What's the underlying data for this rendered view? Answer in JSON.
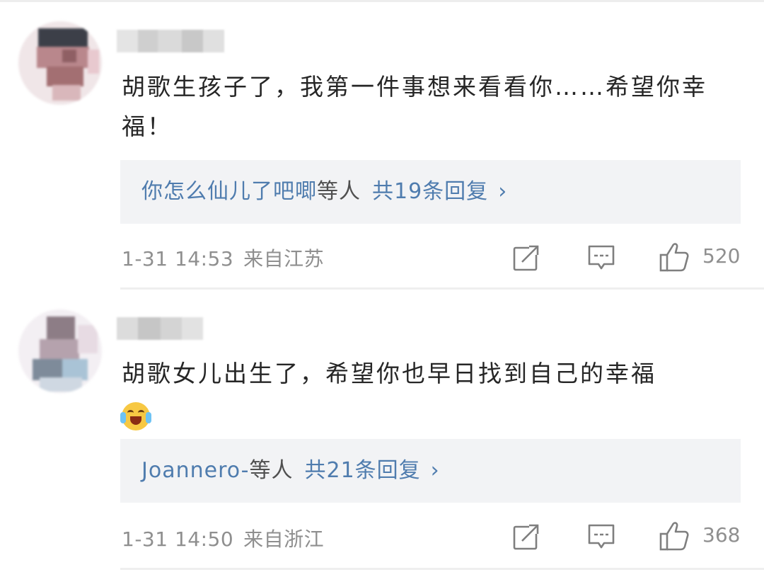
{
  "comments": [
    {
      "text": "胡歌生孩子了，我第一件事想来看看你……希望你幸福！",
      "has_emoji": false,
      "reply": {
        "users": "你怎么仙儿了吧唧",
        "suffix": "等人",
        "count_label": "共19条回复",
        "chevron": "›"
      },
      "time": "1-31 14:53",
      "location": "来自江苏",
      "likes": "520",
      "icons": {
        "share": "share-icon",
        "comment": "comment-icon",
        "like": "thumb-up-icon"
      }
    },
    {
      "text": "胡歌女儿出生了，希望你也早日找到自己的幸福",
      "has_emoji": true,
      "emoji_name": "crying-laughing-emoji",
      "reply": {
        "users": "Joannero-",
        "suffix": "等人",
        "count_label": "共21条回复",
        "chevron": "›"
      },
      "time": "1-31 14:50",
      "location": "来自浙江",
      "likes": "368",
      "icons": {
        "share": "share-icon",
        "comment": "comment-icon",
        "like": "thumb-up-icon"
      }
    }
  ],
  "colors": {
    "link": "#4f7cae",
    "meta": "#8f8f8f",
    "text": "#262626",
    "reply_bg": "#f2f3f5"
  }
}
